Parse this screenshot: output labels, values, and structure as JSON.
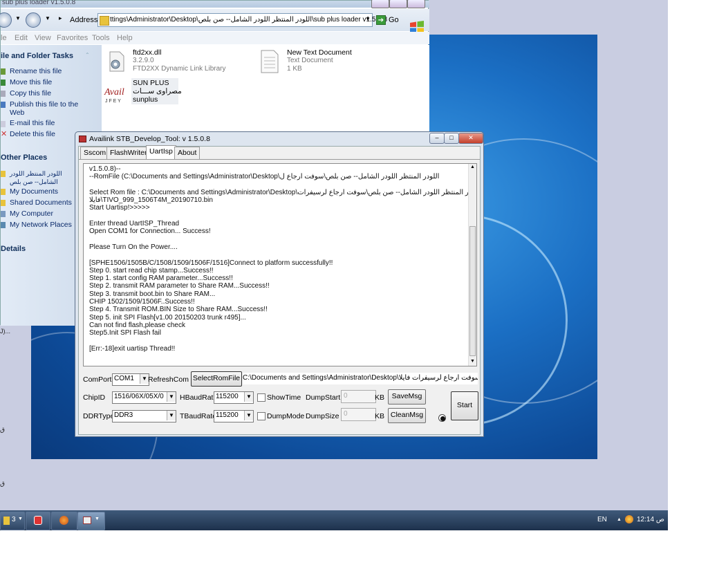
{
  "explorer": {
    "title": "sub plus loader v1.5.0.8",
    "address_label": "Address",
    "address_value": "ttings\\Administrator\\Desktop\\اللودر المنتظر اللودر الشامل-- صن بلص\\sub plus loader v1.5.0.8",
    "go_label": "Go",
    "menu": [
      "le",
      "Edit",
      "View",
      "Favorites",
      "Tools",
      "Help"
    ],
    "file_folder_tasks_title": "ile and Folder Tasks",
    "tasks": [
      "Rename this file",
      "Move this file",
      "Copy this file",
      "Publish this file to the Web",
      "E-mail this file",
      "Delete this file"
    ],
    "other_places_title": "Other Places",
    "other_places": [
      "اللودر المنتظر اللودر الشامل-- صن بلص",
      "My Documents",
      "Shared Documents",
      "My Computer",
      "My Network Places"
    ],
    "details_title": "Details",
    "files": [
      {
        "name": "ftd2xx.dll",
        "line2": "3.2.9.0",
        "line3": "FTD2XX Dynamic Link Library"
      },
      {
        "name": "New Text Document",
        "line2": "Text Document",
        "line3": "1 KB"
      },
      {
        "name": "SUN PLUS",
        "line2": "مصراوى ســـات",
        "line3": "sunplus"
      }
    ]
  },
  "tool": {
    "title": "Availink STB_Develop_Tool: v 1.5.0.8",
    "tabs": [
      "Sscom",
      "FlashWriter",
      "UartIsp",
      "About"
    ],
    "log": "v1.5.0.8)--\n--RomFile (C:\\Documents and Settings\\Administrator\\Desktop\\اللودر المنتظر اللودر الشامل-- صن بلص\\سوفت ارجاع ل\n\nSelect Rom file : C:\\Documents and Settings\\Administrator\\Desktop\\اللودر المنتظر اللودر الشامل-- صن بلص\\سوفت ارجاع لرسيفرات\nفايلا\\TIVO_999_1506T4M_20190710.bin\nStart Uartisp!>>>>>\n\nEnter thread UartISP_Thread\nOpen COM1 for Connection... Success!\n\nPlease Turn On the Power....\n\n[SPHE1506/1505B/C/1508/1509/1506F/1516]Connect to platform successfully!!\nStep 0. start read chip stamp...Success!!\nStep 1. start config RAM parameter...Success!!\nStep 2. transmit RAM parameter to Share RAM...Success!!\nStep 3. transmit boot.bin to Share RAM...\nCHIP 1502/1509/1506F..Success!!\nStep 4. Transmit ROM.BIN Size to Share RAM...Success!!\nStep 5. init SPI Flash[v1.00 20150203 trunk r495]...\nCan not find flash,please check\nStep5.Init SPI Flash fail\n\n[Err:-18]exit uartisp Thread!!",
    "comport_label": "ComPort",
    "comport_value": "COM1",
    "refresh_label": "RefreshCom",
    "select_rom_label": "SelectRomFile",
    "rom_path": "C:\\Documents and Settings\\Administrator\\Desktop\\سوفت ارجاع لرسيفرات فايلا",
    "chipid_label": "ChipID",
    "chipid_value": "1516/06X/05X/0",
    "hbaud_label": "HBaudRate",
    "hbaud_value": "115200",
    "showtime_label": "ShowTime",
    "dumpstart_label": "DumpStart",
    "dumpstart_value": "0",
    "kb1": "KB",
    "savemsg_label": "SaveMsg",
    "ddrtype_label": "DDRType",
    "ddrtype_value": "DDR3",
    "tbaud_label": "TBaudRate",
    "tbaud_value": "115200",
    "dumpmode_label": "DumpMode",
    "dumpsize_label": "DumpSize",
    "dumpsize_value": "0",
    "kb2": "KB",
    "cleanmsg_label": "CleanMsg",
    "start_label": "Start"
  },
  "taskbar": {
    "explorer_count": "3",
    "lang": "EN",
    "clock": "12:14 ص"
  },
  "desktop": {
    "label1": "J)...",
    "label2": "ق",
    "label3": "ق"
  }
}
